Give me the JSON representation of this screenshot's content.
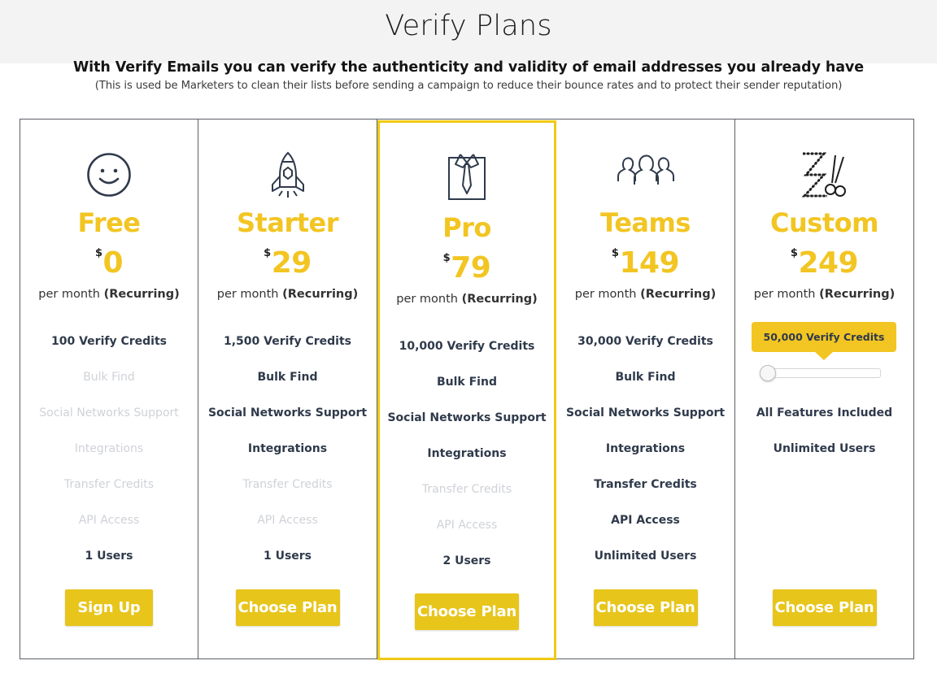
{
  "header": {
    "title": "Verify Plans",
    "subtitle": "With Verify Emails you can verify the authenticity and validity of email addresses you already have",
    "note": "(This is used be Marketers to clean their lists before sending a campaign to reduce their bounce rates and to protect their sender reputation)"
  },
  "colors": {
    "accent": "#f2c522",
    "button": "#e7c51b",
    "text": "#2f3a4b",
    "disabled": "#cfd2d7",
    "border": "#5b5f66"
  },
  "plans": [
    {
      "icon": "smiley-icon",
      "name": "Free",
      "currency": "$",
      "price": "0",
      "period": "per month",
      "period_note": "(Recurring)",
      "features": [
        "100 Verify Credits",
        "Bulk Find",
        "Social Networks Support",
        "Integrations",
        "Transfer Credits",
        "API Access",
        "1 Users"
      ],
      "features_enabled": [
        true,
        false,
        false,
        false,
        false,
        false,
        true
      ],
      "button": "Sign Up"
    },
    {
      "icon": "rocket-icon",
      "name": "Starter",
      "currency": "$",
      "price": "29",
      "period": "per month",
      "period_note": "(Recurring)",
      "features": [
        "1,500 Verify Credits",
        "Bulk Find",
        "Social Networks Support",
        "Integrations",
        "Transfer Credits",
        "API Access",
        "1 Users"
      ],
      "features_enabled": [
        true,
        true,
        true,
        true,
        false,
        false,
        true
      ],
      "button": "Choose Plan"
    },
    {
      "icon": "shirt-tie-icon",
      "name": "Pro",
      "currency": "$",
      "price": "79",
      "period": "per month",
      "period_note": "(Recurring)",
      "features": [
        "10,000 Verify Credits",
        "Bulk Find",
        "Social Networks Support",
        "Integrations",
        "Transfer Credits",
        "API Access",
        "2 Users"
      ],
      "features_enabled": [
        true,
        true,
        true,
        true,
        false,
        false,
        true
      ],
      "button": "Choose Plan",
      "highlighted": true
    },
    {
      "icon": "team-icon",
      "name": "Teams",
      "currency": "$",
      "price": "149",
      "period": "per month",
      "period_note": "(Recurring)",
      "features": [
        "30,000 Verify Credits",
        "Bulk Find",
        "Social Networks Support",
        "Integrations",
        "Transfer Credits",
        "API Access",
        "Unlimited Users"
      ],
      "features_enabled": [
        true,
        true,
        true,
        true,
        true,
        true,
        true
      ],
      "button": "Choose Plan"
    },
    {
      "icon": "tailor-scissors-icon",
      "name": "Custom",
      "currency": "$",
      "price": "249",
      "period": "per month",
      "period_note": "(Recurring)",
      "credits_tooltip": "50,000 Verify Credits",
      "slider_value": 0,
      "features": [
        "All Features Included",
        "Unlimited Users"
      ],
      "button": "Choose Plan"
    }
  ]
}
